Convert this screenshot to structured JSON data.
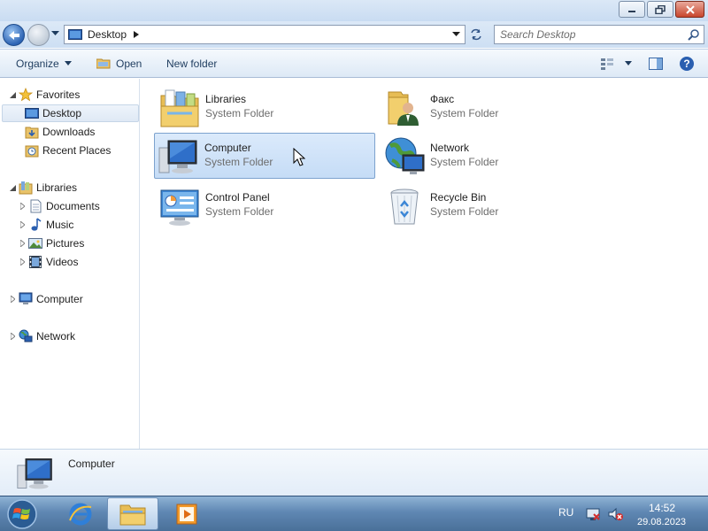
{
  "window": {
    "minimize_icon": "minimize-icon",
    "maximize_icon": "restore-icon",
    "close_icon": "close-icon"
  },
  "address_bar": {
    "path": "Desktop",
    "search_placeholder": "Search Desktop"
  },
  "toolbar": {
    "organize_label": "Organize",
    "open_label": "Open",
    "new_folder_label": "New folder"
  },
  "sidebar": {
    "favorites": {
      "label": "Favorites",
      "items": [
        {
          "label": "Desktop",
          "icon": "desktop-icon",
          "selected": true
        },
        {
          "label": "Downloads",
          "icon": "downloads-icon"
        },
        {
          "label": "Recent Places",
          "icon": "recent-places-icon"
        }
      ]
    },
    "libraries": {
      "label": "Libraries",
      "items": [
        {
          "label": "Documents",
          "icon": "documents-icon"
        },
        {
          "label": "Music",
          "icon": "music-icon"
        },
        {
          "label": "Pictures",
          "icon": "pictures-icon"
        },
        {
          "label": "Videos",
          "icon": "videos-icon"
        }
      ]
    },
    "computer": {
      "label": "Computer"
    },
    "network": {
      "label": "Network"
    }
  },
  "content": {
    "items": [
      {
        "name": "Libraries",
        "type": "System Folder",
        "icon": "libraries-folder-icon"
      },
      {
        "name": "Факс",
        "type": "System Folder",
        "icon": "fax-user-folder-icon"
      },
      {
        "name": "Computer",
        "type": "System Folder",
        "icon": "computer-icon",
        "selected": true
      },
      {
        "name": "Network",
        "type": "System Folder",
        "icon": "network-icon"
      },
      {
        "name": "Control Panel",
        "type": "System Folder",
        "icon": "control-panel-icon"
      },
      {
        "name": "Recycle Bin",
        "type": "System Folder",
        "icon": "recycle-bin-icon"
      }
    ]
  },
  "details_pane": {
    "name": "Computer"
  },
  "taskbar": {
    "language": "RU",
    "time": "14:52",
    "date": "29.08.2023"
  },
  "colors": {
    "selection_fill": "#cfe3f8",
    "selection_border": "#7da2ce",
    "taskbar": "#5f87b3"
  }
}
